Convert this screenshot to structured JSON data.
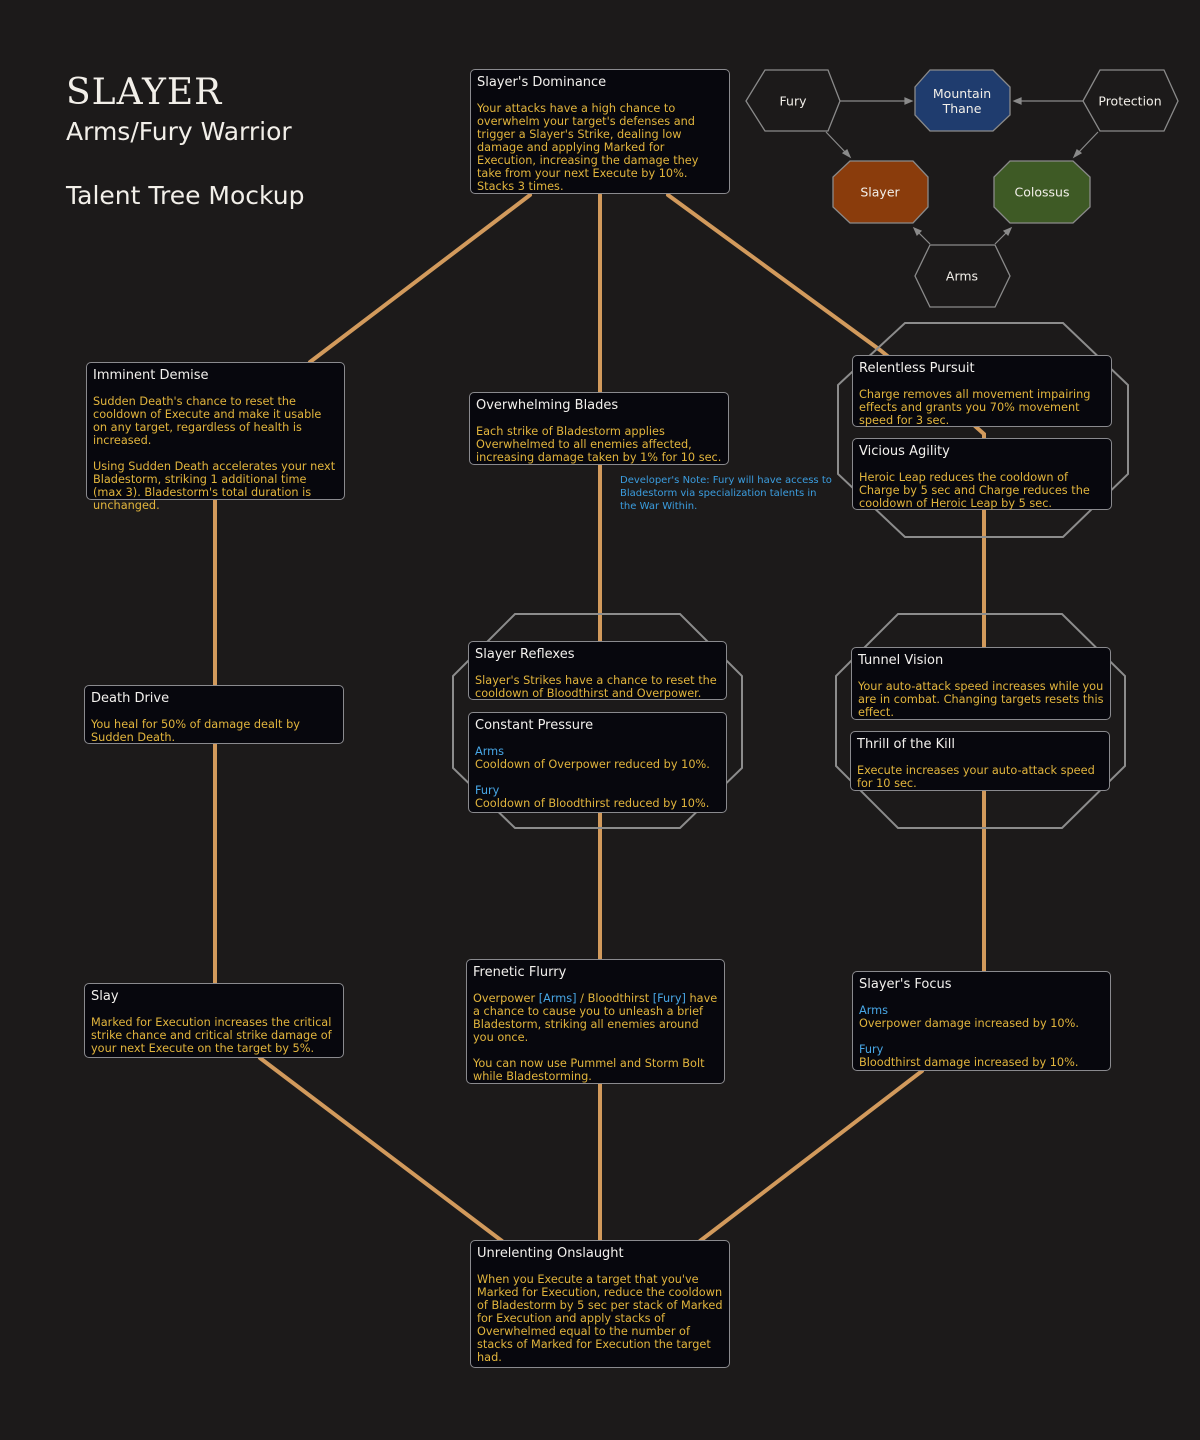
{
  "header": {
    "title": "SLAYER",
    "subtitle": "Arms/Fury Warrior",
    "caption": "Talent Tree Mockup"
  },
  "colors": {
    "background": "#1c1a1a",
    "connector": "#d29a5c",
    "card_bg": "#07070d",
    "card_border": "#8a8a8e",
    "talent_name": "#f3f1ee",
    "talent_desc": "#e2b53d",
    "spec_label": "#48a7e6",
    "mountain_thane": "#1f3c6e",
    "slayer": "#8a3c0c",
    "colossus": "#3e5a25"
  },
  "hero_map": {
    "nodes": [
      {
        "id": "fury",
        "label": "Fury",
        "kind": "spec"
      },
      {
        "id": "mountain-thane",
        "label": "Mountain\nThane",
        "kind": "hero"
      },
      {
        "id": "protection",
        "label": "Protection",
        "kind": "spec"
      },
      {
        "id": "slayer",
        "label": "Slayer",
        "kind": "hero"
      },
      {
        "id": "colossus",
        "label": "Colossus",
        "kind": "hero"
      },
      {
        "id": "arms",
        "label": "Arms",
        "kind": "spec"
      }
    ],
    "edges": [
      {
        "from": "fury",
        "to": "mountain-thane"
      },
      {
        "from": "protection",
        "to": "mountain-thane"
      },
      {
        "from": "fury",
        "to": "slayer"
      },
      {
        "from": "protection",
        "to": "colossus"
      },
      {
        "from": "arms",
        "to": "slayer"
      },
      {
        "from": "arms",
        "to": "colossus"
      }
    ]
  },
  "talents": {
    "slayers_dominance": {
      "name": "Slayer's Dominance",
      "desc": "Your attacks have a high chance to overwhelm your target's defenses and trigger a Slayer's Strike, dealing low damage and applying Marked for Execution, increasing the damage they take from your next Execute by 10%.\nStacks 3 times."
    },
    "imminent_demise": {
      "name": "Imminent Demise",
      "desc": "Sudden Death's chance to reset the cooldown of Execute and make it usable on any target, regardless of health is increased.",
      "desc2": "Using Sudden Death accelerates your next Bladestorm, striking 1 additional time (max 3). Bladestorm's total duration is unchanged."
    },
    "overwhelming_blades": {
      "name": "Overwhelming Blades",
      "desc": "Each strike of Bladestorm applies Overwhelmed to all enemies affected, increasing damage taken by 1% for 10 sec."
    },
    "relentless_pursuit": {
      "name": "Relentless Pursuit",
      "desc": "Charge removes all movement impairing effects and grants you 70% movement speed for 3 sec."
    },
    "vicious_agility": {
      "name": "Vicious Agility",
      "desc": "Heroic Leap reduces the cooldown of Charge by 5 sec and Charge reduces the cooldown of Heroic Leap by 5 sec."
    },
    "death_drive": {
      "name": "Death Drive",
      "desc": "You heal for 50% of damage dealt by Sudden Death."
    },
    "slayer_reflexes": {
      "name": "Slayer Reflexes",
      "desc": "Slayer's Strikes have a chance to reset the cooldown of Bloodthirst and Overpower."
    },
    "constant_pressure": {
      "name": "Constant Pressure",
      "arms_label": "Arms",
      "arms_desc": "Cooldown of Overpower reduced by 10%.",
      "fury_label": "Fury",
      "fury_desc": "Cooldown of Bloodthirst reduced by 10%."
    },
    "tunnel_vision": {
      "name": "Tunnel Vision",
      "desc": "Your auto-attack speed increases while you are in combat. Changing targets resets this effect."
    },
    "thrill_of_the_kill": {
      "name": "Thrill of the Kill",
      "desc": "Execute increases your auto-attack speed for 10 sec."
    },
    "slay": {
      "name": "Slay",
      "desc": "Marked for Execution increases the critical strike chance and critical strike damage of your next Execute on the target by 5%."
    },
    "frenetic_flurry": {
      "name": "Frenetic Flurry",
      "desc_a": "Overpower ",
      "tag_arms": "[Arms]",
      "desc_b": " / Bloodthirst ",
      "tag_fury": "[Fury]",
      "desc_c": " have a chance to cause you to unleash a brief Bladestorm, striking all enemies around you once.",
      "desc2": "You can now use Pummel and Storm Bolt while Bladestorming."
    },
    "slayers_focus": {
      "name": "Slayer's Focus",
      "arms_label": "Arms",
      "arms_desc": "Overpower damage increased by 10%.",
      "fury_label": "Fury",
      "fury_desc": "Bloodthirst damage increased by 10%."
    },
    "unrelenting_onslaught": {
      "name": "Unrelenting Onslaught",
      "desc": "When you Execute a target that you've Marked for Execution, reduce the cooldown of Bladestorm by 5 sec per stack of Marked for Execution and apply stacks of Overwhelmed equal to the number of stacks of Marked for Execution the target had."
    }
  },
  "developer_note": "Developer's Note: Fury will have access to Bladestorm via specialization talents in the War Within."
}
